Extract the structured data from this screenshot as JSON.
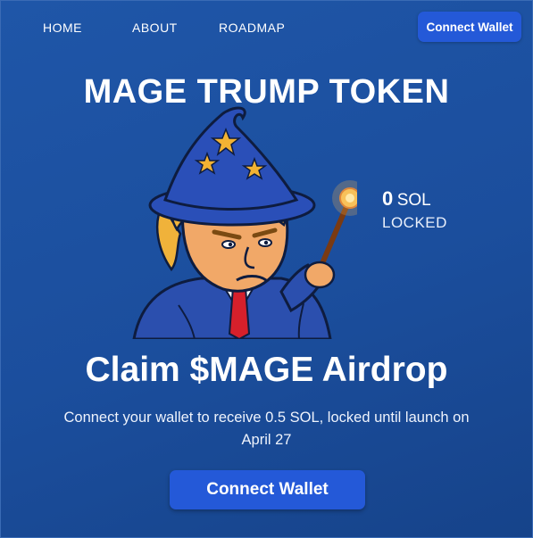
{
  "nav": {
    "items": [
      {
        "label": "HOME"
      },
      {
        "label": "ABOUT"
      },
      {
        "label": "ROADMAP"
      }
    ],
    "connect_label": "Connect Wallet"
  },
  "hero": {
    "title": "MAGE TRUMP TOKEN",
    "mascot_icon": "wizard-mascot-icon",
    "sol_amount": "0",
    "sol_unit": "SOL",
    "sol_status": "LOCKED"
  },
  "claim": {
    "title": "Claim $MAGE Airdrop",
    "subtitle": "Connect your wallet to receive 0.5 SOL, locked until launch on April 27",
    "button_label": "Connect Wallet"
  },
  "colors": {
    "background": "#1f56a8",
    "button": "#2459d8",
    "hat": "#2a4fb8",
    "star": "#f2b233",
    "hair": "#f0b23a",
    "tie": "#d6202b"
  }
}
